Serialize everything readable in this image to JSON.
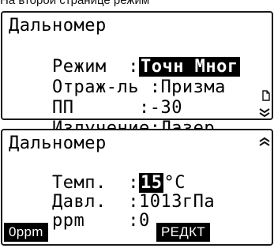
{
  "caption": "На второй странице режим",
  "screen1": {
    "title": "Дальномер",
    "rows": [
      {
        "label": "Режим  :",
        "value": "Точн Мног",
        "highlighted": true
      },
      {
        "label": "Отраж-ль :",
        "value": "Призма"
      },
      {
        "label": "ПП      :",
        "value": "-30"
      },
      {
        "label": "Излучение:",
        "value": "Лазер"
      }
    ],
    "icons": {
      "side": "page-indicator-icon",
      "scroll": "scroll-down-icon"
    }
  },
  "screen2": {
    "title": "Дальномер",
    "rows": [
      {
        "label": "Темп.  :",
        "value": "15",
        "unit": "°C"
      },
      {
        "label": "Давл.  :",
        "value": "1013гПа"
      },
      {
        "label": "ppm    :",
        "value": "0"
      }
    ],
    "softkeys": [
      "0ppm",
      "РЕДКТ"
    ],
    "icons": {
      "scroll": "scroll-up-icon"
    }
  }
}
